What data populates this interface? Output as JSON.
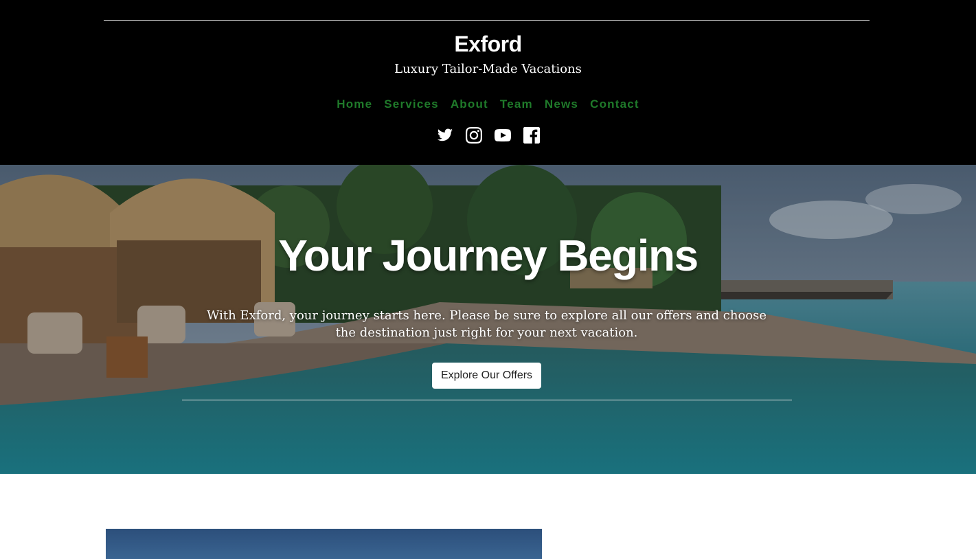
{
  "header": {
    "brand": "Exford",
    "tagline": "Luxury Tailor-Made Vacations",
    "nav": [
      {
        "label": "Home"
      },
      {
        "label": "Services"
      },
      {
        "label": "About"
      },
      {
        "label": "Team"
      },
      {
        "label": "News"
      },
      {
        "label": "Contact"
      }
    ],
    "social_icons": [
      "twitter-icon",
      "instagram-icon",
      "youtube-icon",
      "facebook-icon"
    ],
    "nav_color": "#1f7a2a",
    "background": "#000000"
  },
  "hero": {
    "title": "Your Journey Begins",
    "text": "With Exford, your journey starts here. Please be sure to explore all our offers and choose the destination just right for your next vacation.",
    "button_label": "Explore Our Offers"
  }
}
